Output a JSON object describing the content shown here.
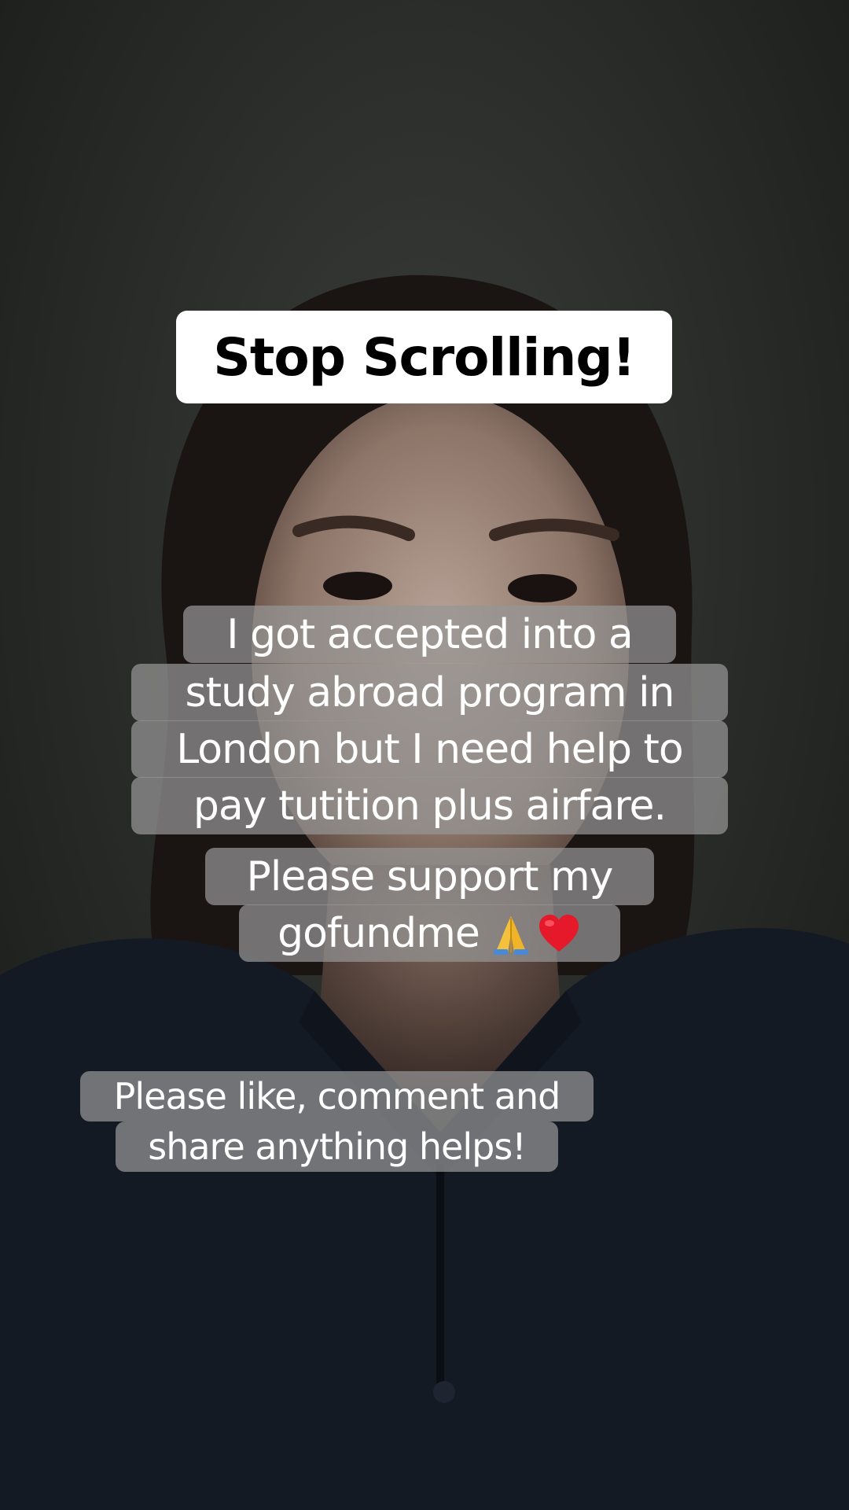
{
  "title_sticker": {
    "text": "Stop Scrolling!"
  },
  "main_caption": {
    "lines": [
      "I got accepted into a",
      "study abroad program in",
      "London but I need help to",
      "pay tutition plus airfare.",
      "Please support my",
      "gofundme"
    ],
    "emojis": [
      "folded-hands",
      "red-heart"
    ]
  },
  "secondary_caption": {
    "lines": [
      "Please like, comment and",
      "share anything helps!"
    ]
  },
  "colors": {
    "background": "#1c1e1c",
    "title_box": "#ffffff",
    "caption_bubble": "#969696",
    "caption_text": "#ffffff"
  }
}
